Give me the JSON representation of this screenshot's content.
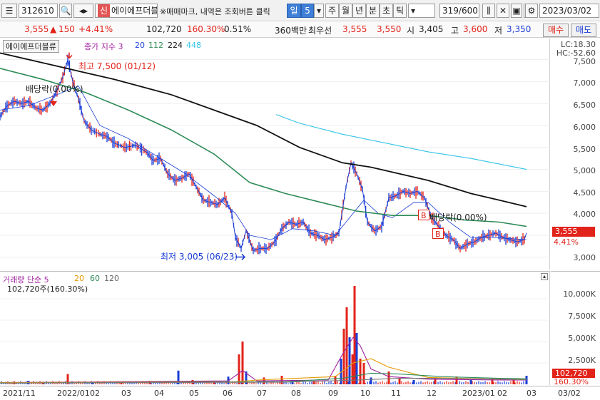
{
  "toolbar": {
    "code": "312610",
    "market_badge": "신",
    "name": "에이에프더블",
    "notice": "※매매마크, 내역은 조회버튼 클릭",
    "period_sel": "일",
    "period_num": "5",
    "period_tabs": [
      "주",
      "월",
      "년",
      "분",
      "초",
      "틱"
    ],
    "count": "319/600",
    "date": "2023/03/02"
  },
  "quote": {
    "price": "3,555",
    "change": "150",
    "change_pct": "+4.41%",
    "volume": "102,720",
    "vol_ratio": "160.30%",
    "turnover": "0.51%",
    "ma_line_label": "360백만",
    "best_bid_label": "최우선",
    "best_ask": "3,555",
    "best_bid": "3,550",
    "open_label": "시",
    "open": "3,405",
    "high_label": "고",
    "high": "3,600",
    "low_label": "저",
    "low": "3,350",
    "buy_button": "매수",
    "sell_button": "매도"
  },
  "price_pane": {
    "name_tag": "에이에프더블류",
    "legend_title": "종가 지수 3",
    "ma": [
      "20",
      "112",
      "224",
      "448"
    ],
    "lc": "LC:18.30",
    "hc": "HC:-52.60",
    "current_price": "3,555",
    "current_pct": "4.41%",
    "y_ticks": [
      "7,500",
      "7,000",
      "6,500",
      "6,000",
      "5,500",
      "5,000",
      "4,500",
      "4,000",
      "3,500",
      "3,000"
    ],
    "high_note": "최고 7,500 (01/12)",
    "low_note": "최저 3,005 (06/23)",
    "div_note_1": "배당락(0.00%)",
    "div_note_2": "배당락(0.00%)",
    "b_marker": "B"
  },
  "volume_pane": {
    "legend_title": "거래량 단순 5",
    "ma": [
      "20",
      "60",
      "120"
    ],
    "volume_text": "102,720주(160.30%)",
    "y_ticks": [
      "10,000K",
      "7,500K",
      "5,000K",
      "2,500K"
    ],
    "current_vol": "102,720",
    "current_pct": "160.30%"
  },
  "x_ticks": [
    "2021/11",
    "2022/01",
    "02",
    "03",
    "04",
    "05",
    "06",
    "07",
    "08",
    "09",
    "10",
    "11",
    "12",
    "2023/01",
    "02",
    "03",
    "03/02"
  ],
  "colors": {
    "up": "#e2231a",
    "down": "#1a3dd6",
    "ma20": "#1a3dd6",
    "ma112": "#2e8b57",
    "ma224": "#111111",
    "ma448": "#33c3e8"
  },
  "chart_data": [
    {
      "type": "line",
      "title": "에이에프더블류",
      "series": [
        {
          "name": "종가",
          "points": [
            [
              0,
              6200
            ],
            [
              10,
              6450
            ],
            [
              20,
              6550
            ],
            [
              30,
              6500
            ],
            [
              40,
              6550
            ],
            [
              50,
              6400
            ],
            [
              60,
              6350
            ],
            [
              70,
              6500
            ],
            [
              80,
              6800
            ],
            [
              88,
              7100
            ],
            [
              95,
              7500
            ],
            [
              102,
              7000
            ],
            [
              110,
              6600
            ],
            [
              118,
              6100
            ],
            [
              128,
              5900
            ],
            [
              140,
              5800
            ],
            [
              150,
              5750
            ],
            [
              160,
              5600
            ],
            [
              175,
              5500
            ],
            [
              190,
              5550
            ],
            [
              205,
              5400
            ],
            [
              215,
              5200
            ],
            [
              225,
              5250
            ],
            [
              235,
              4900
            ],
            [
              245,
              4750
            ],
            [
              255,
              4800
            ],
            [
              265,
              4900
            ],
            [
              275,
              4600
            ],
            [
              285,
              4300
            ],
            [
              295,
              4250
            ],
            [
              305,
              4200
            ],
            [
              315,
              4350
            ],
            [
              325,
              4000
            ],
            [
              330,
              3450
            ],
            [
              338,
              3200
            ],
            [
              345,
              3600
            ],
            [
              355,
              3150
            ],
            [
              365,
              3200
            ],
            [
              375,
              3200
            ],
            [
              385,
              3350
            ],
            [
              395,
              3650
            ],
            [
              405,
              3800
            ],
            [
              415,
              3750
            ],
            [
              425,
              3800
            ],
            [
              435,
              3550
            ],
            [
              445,
              3500
            ],
            [
              455,
              3400
            ],
            [
              465,
              3450
            ],
            [
              475,
              3550
            ],
            [
              485,
              4600
            ],
            [
              492,
              5150
            ],
            [
              500,
              4900
            ],
            [
              508,
              4550
            ],
            [
              515,
              3800
            ],
            [
              525,
              3600
            ],
            [
              535,
              3700
            ],
            [
              545,
              4350
            ],
            [
              555,
              4400
            ],
            [
              565,
              4500
            ],
            [
              575,
              4450
            ],
            [
              585,
              4500
            ],
            [
              595,
              4350
            ],
            [
              605,
              3900
            ],
            [
              615,
              3700
            ],
            [
              625,
              3500
            ],
            [
              635,
              3400
            ],
            [
              645,
              3200
            ],
            [
              655,
              3300
            ],
            [
              665,
              3350
            ],
            [
              675,
              3450
            ],
            [
              685,
              3500
            ],
            [
              695,
              3550
            ],
            [
              705,
              3450
            ],
            [
              715,
              3400
            ],
            [
              725,
              3350
            ],
            [
              735,
              3405
            ],
            [
              738,
              3555
            ]
          ]
        },
        {
          "name": "20",
          "points": [
            [
              0,
              6350
            ],
            [
              40,
              6450
            ],
            [
              80,
              6700
            ],
            [
              110,
              6900
            ],
            [
              140,
              6000
            ],
            [
              180,
              5700
            ],
            [
              220,
              5300
            ],
            [
              260,
              4900
            ],
            [
              300,
              4400
            ],
            [
              330,
              4000
            ],
            [
              350,
              3500
            ],
            [
              380,
              3400
            ],
            [
              410,
              3650
            ],
            [
              440,
              3600
            ],
            [
              470,
              3500
            ],
            [
              490,
              3900
            ],
            [
              510,
              4300
            ],
            [
              530,
              4000
            ],
            [
              550,
              3900
            ],
            [
              580,
              4250
            ],
            [
              600,
              4250
            ],
            [
              630,
              3800
            ],
            [
              660,
              3450
            ],
            [
              690,
              3450
            ],
            [
              738,
              3400
            ]
          ]
        },
        {
          "name": "112",
          "points": [
            [
              0,
              7300
            ],
            [
              60,
              7050
            ],
            [
              120,
              6750
            ],
            [
              180,
              6350
            ],
            [
              240,
              5900
            ],
            [
              300,
              5350
            ],
            [
              350,
              4700
            ],
            [
              400,
              4450
            ],
            [
              450,
              4250
            ],
            [
              500,
              4050
            ],
            [
              550,
              3950
            ],
            [
              600,
              3950
            ],
            [
              650,
              3850
            ],
            [
              700,
              3800
            ],
            [
              738,
              3700
            ]
          ]
        },
        {
          "name": "224",
          "points": [
            [
              0,
              7650
            ],
            [
              80,
              7350
            ],
            [
              160,
              7050
            ],
            [
              240,
              6700
            ],
            [
              300,
              6350
            ],
            [
              360,
              6000
            ],
            [
              420,
              5500
            ],
            [
              480,
              5150
            ],
            [
              520,
              5050
            ],
            [
              560,
              4900
            ],
            [
              600,
              4750
            ],
            [
              660,
              4450
            ],
            [
              700,
              4300
            ],
            [
              738,
              4150
            ]
          ]
        },
        {
          "name": "448",
          "points": [
            [
              387,
              6250
            ],
            [
              420,
              6050
            ],
            [
              480,
              5800
            ],
            [
              540,
              5600
            ],
            [
              600,
              5400
            ],
            [
              660,
              5250
            ],
            [
              738,
              5000
            ]
          ]
        }
      ],
      "ylim": [
        2850,
        7850
      ],
      "y_ticks": [
        7500,
        7000,
        6500,
        6000,
        5500,
        5000,
        4500,
        4000,
        3500,
        3000
      ]
    },
    {
      "type": "bar",
      "title": "거래량 단순 5",
      "bars": [
        [
          20,
          300
        ],
        [
          40,
          400
        ],
        [
          60,
          250
        ],
        [
          95,
          1200
        ],
        [
          130,
          300
        ],
        [
          170,
          200
        ],
        [
          210,
          400
        ],
        [
          250,
          1600
        ],
        [
          270,
          500
        ],
        [
          300,
          300
        ],
        [
          320,
          900
        ],
        [
          335,
          3500
        ],
        [
          340,
          5000
        ],
        [
          345,
          1500
        ],
        [
          370,
          800
        ],
        [
          395,
          1000
        ],
        [
          410,
          500
        ],
        [
          440,
          400
        ],
        [
          470,
          1000
        ],
        [
          478,
          3000
        ],
        [
          482,
          6500
        ],
        [
          486,
          9000
        ],
        [
          490,
          5500
        ],
        [
          494,
          3500
        ],
        [
          497,
          11500
        ],
        [
          500,
          6000
        ],
        [
          505,
          3000
        ],
        [
          510,
          2500
        ],
        [
          520,
          800
        ],
        [
          545,
          1500
        ],
        [
          560,
          700
        ],
        [
          580,
          500
        ],
        [
          610,
          800
        ],
        [
          640,
          900
        ],
        [
          660,
          500
        ],
        [
          690,
          700
        ],
        [
          720,
          600
        ],
        [
          738,
          1000
        ]
      ],
      "ma_series": [
        {
          "name": "5",
          "points": [
            [
              0,
              200
            ],
            [
              320,
              400
            ],
            [
              340,
              1600
            ],
            [
              360,
              400
            ],
            [
              460,
              500
            ],
            [
              480,
              3500
            ],
            [
              495,
              5500
            ],
            [
              505,
              4500
            ],
            [
              520,
              1800
            ],
            [
              545,
              900
            ],
            [
              600,
              600
            ],
            [
              700,
              500
            ],
            [
              738,
              500
            ]
          ]
        },
        {
          "name": "20",
          "points": [
            [
              0,
              200
            ],
            [
              330,
              300
            ],
            [
              360,
              500
            ],
            [
              470,
              900
            ],
            [
              495,
              2500
            ],
            [
              520,
              3000
            ],
            [
              545,
              2000
            ],
            [
              600,
              800
            ],
            [
              700,
              600
            ],
            [
              738,
              550
            ]
          ]
        },
        {
          "name": "60",
          "points": [
            [
              0,
              150
            ],
            [
              400,
              300
            ],
            [
              480,
              700
            ],
            [
              520,
              1300
            ],
            [
              560,
              1200
            ],
            [
              620,
              900
            ],
            [
              700,
              700
            ],
            [
              738,
              650
            ]
          ]
        },
        {
          "name": "120",
          "points": [
            [
              0,
              150
            ],
            [
              400,
              250
            ],
            [
              500,
              500
            ],
            [
              560,
              700
            ],
            [
              620,
              700
            ],
            [
              700,
              600
            ],
            [
              738,
              550
            ]
          ]
        }
      ],
      "ylim": [
        0,
        12500
      ],
      "y_ticks": [
        10000,
        7500,
        5000,
        2500
      ],
      "unit": "K"
    }
  ]
}
